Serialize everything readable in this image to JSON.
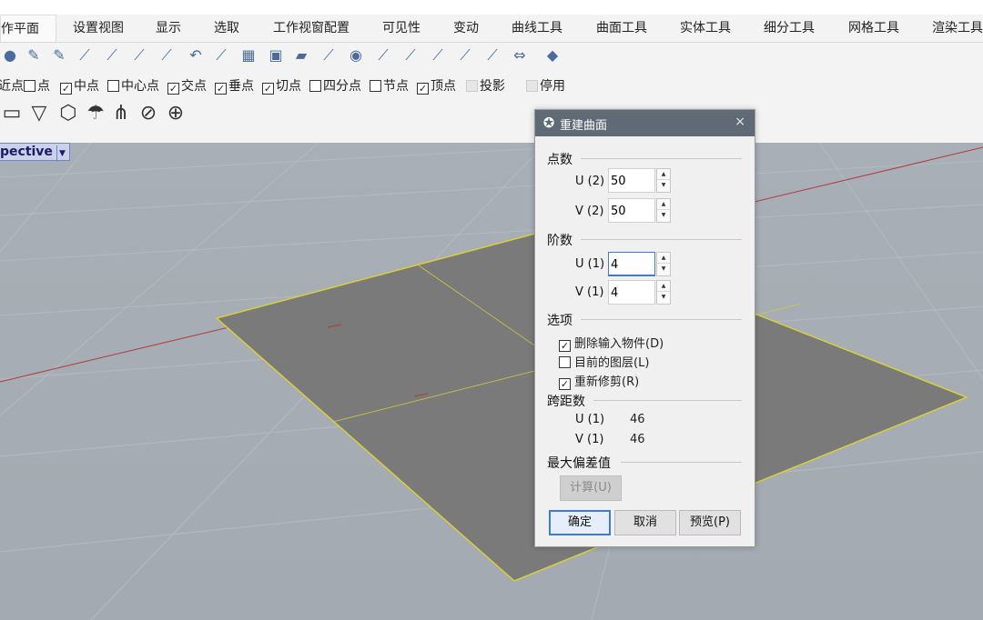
{
  "ribbon": {
    "tabs": [
      {
        "label": "作平面"
      },
      {
        "label": "设置视图"
      },
      {
        "label": "显示"
      },
      {
        "label": "选取"
      },
      {
        "label": "工作视窗配置"
      },
      {
        "label": "可见性"
      },
      {
        "label": "变动"
      },
      {
        "label": "曲线工具"
      },
      {
        "label": "曲面工具"
      },
      {
        "label": "实体工具"
      },
      {
        "label": "细分工具"
      },
      {
        "label": "网格工具"
      },
      {
        "label": "渲染工具"
      }
    ]
  },
  "osnap": {
    "items": [
      {
        "label": "点",
        "checked": false,
        "disabled": false
      },
      {
        "label": "中点",
        "checked": true,
        "disabled": false
      },
      {
        "label": "中心点",
        "checked": false,
        "disabled": false
      },
      {
        "label": "交点",
        "checked": true,
        "disabled": false
      },
      {
        "label": "垂点",
        "checked": true,
        "disabled": false
      },
      {
        "label": "切点",
        "checked": true,
        "disabled": false
      },
      {
        "label": "四分点",
        "checked": false,
        "disabled": false
      },
      {
        "label": "节点",
        "checked": false,
        "disabled": false
      },
      {
        "label": "顶点",
        "checked": true,
        "disabled": false
      },
      {
        "label": "投影",
        "checked": false,
        "disabled": true
      },
      {
        "label": "停用",
        "checked": false,
        "disabled": true
      }
    ],
    "leading_fragment": "近点"
  },
  "viewport": {
    "label": "pective",
    "dropdown_icon": "triangle-down-icon"
  },
  "dialog": {
    "title": "重建曲面",
    "close_glyph": "×",
    "point_count": {
      "section": "点数",
      "u_label": "U (2)",
      "u_value": "50",
      "v_label": "V (2)",
      "v_value": "50"
    },
    "degree": {
      "section": "阶数",
      "u_label": "U (1)",
      "u_value": "4",
      "v_label": "V (1)",
      "v_value": "4"
    },
    "options": {
      "section": "选项",
      "delete_input": {
        "label": "删除输入物件(D)",
        "checked": true
      },
      "current_layer": {
        "label": "目前的图层(L)",
        "checked": false
      },
      "retrim": {
        "label": "重新修剪(R)",
        "checked": true
      }
    },
    "span_count": {
      "section": "跨距数",
      "u_label": "U (1)",
      "u_value": "46",
      "v_label": "V (1)",
      "v_value": "46"
    },
    "max_deviation": {
      "section": "最大偏差值",
      "calc_button": "计算(U)"
    },
    "buttons": {
      "ok": "确定",
      "cancel": "取消",
      "preview": "预览(P)"
    }
  },
  "colors": {
    "viewport_bg": "#a6adb4",
    "surface_fill": "#7a7a7a",
    "surface_edge": "#d8cf3a",
    "x_axis": "#b03a3a",
    "dialog_title_bg": "#5f6a76",
    "accent": "#3d7bd8"
  }
}
